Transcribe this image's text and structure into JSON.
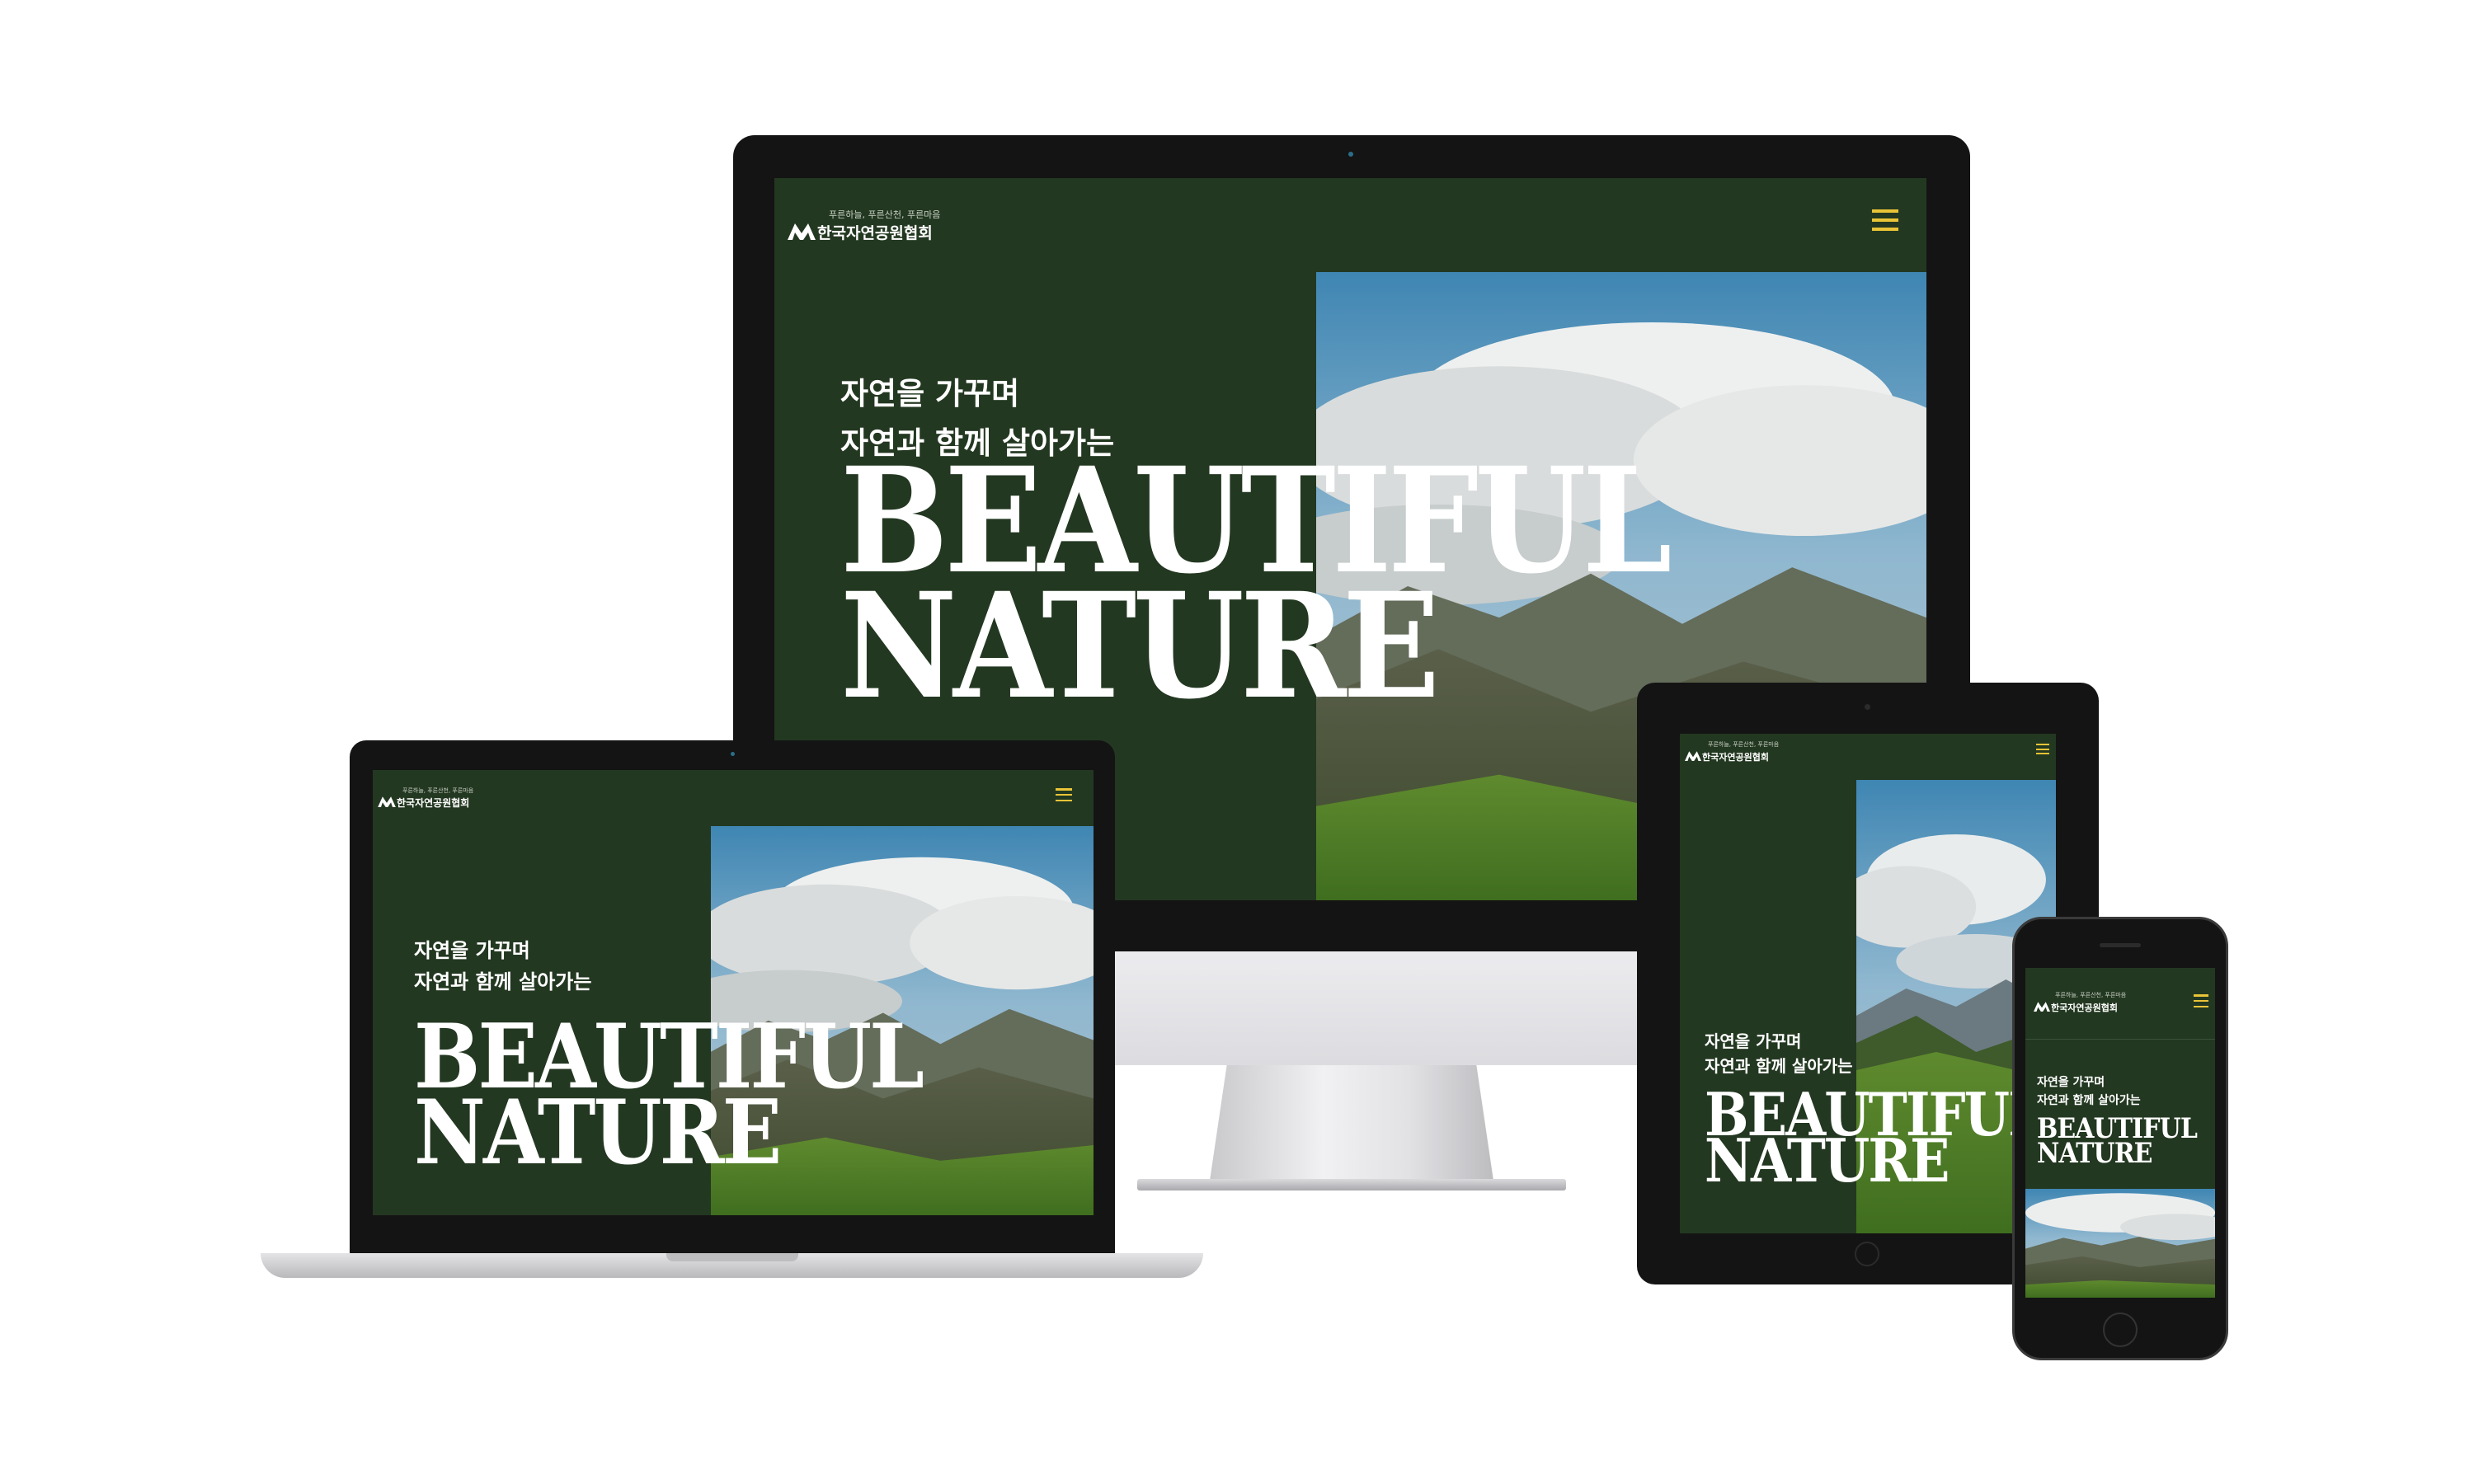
{
  "site": {
    "logo_tagline": "푸른하늘, 푸른산천, 푸른마음",
    "logo_name": "한국자연공원협회",
    "hero_line1": "자연을 가꾸며",
    "hero_line2": "자연과 함께 살아가는",
    "headline_line1": "BEAUTIFUL",
    "headline_line2": "NATURE"
  },
  "colors": {
    "background": "#233821",
    "accent": "#e9c437",
    "text": "#ffffff"
  },
  "icons": [
    "logo-mountain-icon",
    "hamburger-menu-icon"
  ],
  "devices": [
    "desktop-monitor",
    "laptop",
    "tablet",
    "phone"
  ]
}
